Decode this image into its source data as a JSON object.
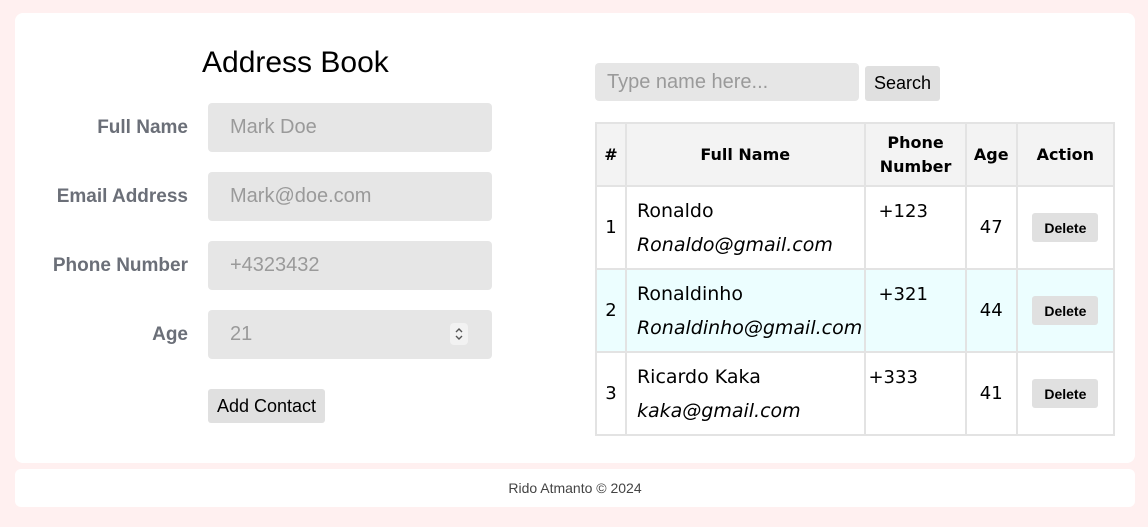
{
  "form": {
    "title": "Address Book",
    "fields": [
      {
        "label": "Full Name",
        "placeholder": "Mark Doe"
      },
      {
        "label": "Email Address",
        "placeholder": "Mark@doe.com"
      },
      {
        "label": "Phone Number",
        "placeholder": "+4323432"
      },
      {
        "label": "Age",
        "placeholder": "21"
      }
    ],
    "add_label": "Add Contact"
  },
  "search": {
    "placeholder": "Type name here...",
    "button_label": "Search"
  },
  "table": {
    "headers": {
      "num": "#",
      "name": "Full Name",
      "phone_1": "Phone",
      "phone_2": "Number",
      "age": "Age",
      "action": "Action"
    },
    "rows": [
      {
        "num": "1",
        "name": "Ronaldo",
        "email": "Ronaldo@gmail.com",
        "phone": "+123",
        "age": "47",
        "action": "Delete"
      },
      {
        "num": "2",
        "name": "Ronaldinho",
        "email": "Ronaldinho@gmail.com",
        "phone": "+321",
        "age": "44",
        "action": "Delete"
      },
      {
        "num": "3",
        "name": "Ricardo Kaka",
        "email": "kaka@gmail.com",
        "phone": "+333",
        "age": "41",
        "action": "Delete"
      }
    ],
    "alt_row_color": "#ecfeff"
  },
  "footer": {
    "text": "Rido Atmanto © 2024"
  },
  "colors": {
    "page_bg": "#fff0f0",
    "field_bg": "#e6e6e6",
    "label": "#6b6f78"
  }
}
